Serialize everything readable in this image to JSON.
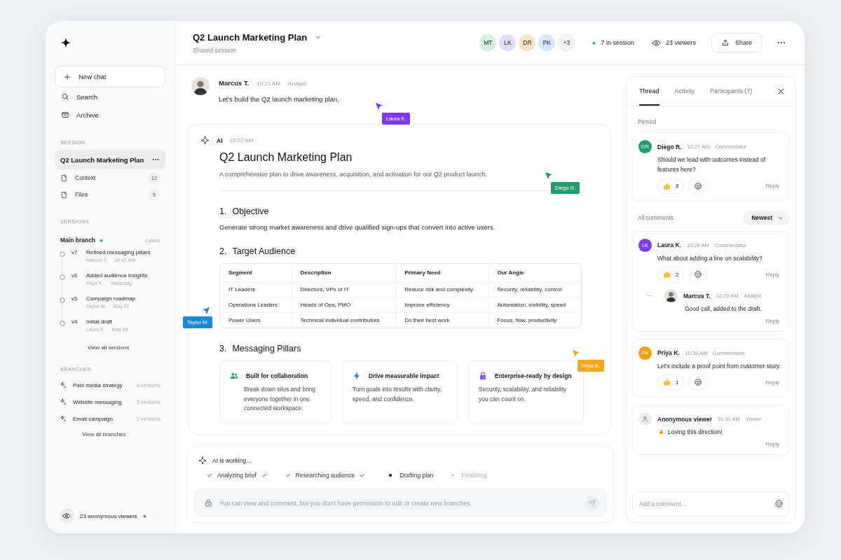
{
  "sidebar": {
    "new_chat": "New chat",
    "nav": [
      {
        "label": "Search",
        "kind": "search"
      },
      {
        "label": "Archive",
        "kind": "archive"
      }
    ],
    "session_heading": "SESSION",
    "session": {
      "title": "Q2 Launch Marketing Plan",
      "selected": true
    },
    "session_items": [
      {
        "label": "Context",
        "count": "12"
      },
      {
        "label": "Files",
        "count": "5"
      }
    ],
    "versions_heading": "VERSIONS",
    "main_branch": {
      "name": "Main branch",
      "badge": "Latest"
    },
    "versions": [
      {
        "version": "v7",
        "title": "Refined messaging pillars",
        "author": "Marcus T.",
        "time": "10:42 AM"
      },
      {
        "version": "v6",
        "title": "Added audience insights",
        "author": "Priya K.",
        "time": "Yesterday"
      },
      {
        "version": "v5",
        "title": "Campaign roadmap",
        "author": "Taylor M.",
        "time": "May 20"
      },
      {
        "version": "v4",
        "title": "Initial draft",
        "author": "Laura K.",
        "time": "May 18"
      }
    ],
    "view_all_versions": "View all versions",
    "branches_heading": "BRANCHES",
    "branches": [
      {
        "name": "Paid media strategy",
        "count": "4 versions"
      },
      {
        "name": "Website messaging",
        "count": "3 versions"
      },
      {
        "name": "Email campaign",
        "count": "2 versions"
      }
    ],
    "view_all_branches": "View all branches",
    "viewers": "23 anonymous viewers"
  },
  "header": {
    "title": "Q2 Launch Marketing Plan",
    "subtitle": "Shared session",
    "avatars": [
      {
        "initials": "MT",
        "color": "#d4eedf"
      },
      {
        "initials": "LK",
        "color": "#e4dafa"
      },
      {
        "initials": "DR",
        "color": "#fde2c4"
      },
      {
        "initials": "PK",
        "color": "#d7e6fb"
      }
    ],
    "more": "+3",
    "in_session": "7 in session",
    "viewers": "23 viewers",
    "share": "Share"
  },
  "chat": {
    "user_message": {
      "author": "Marcus T.",
      "time": "10:21 AM",
      "role": "Analyst",
      "text": "Let's build the Q2 launch marketing plan."
    },
    "ai_message": {
      "author": "AI",
      "time": "10:22 AM",
      "title": "Q2 Launch Marketing Plan",
      "subtitle": "A comprehensive plan to drive awareness, acquisition, and activation for our Q2 product launch.",
      "sections": [
        {
          "number": "1.",
          "heading": "Objective",
          "kind": "text",
          "text": "Generate strong market awareness and drive qualified sign-ups that convert into active users."
        },
        {
          "number": "2.",
          "heading": "Target Audience",
          "kind": "table",
          "table": {
            "columns": [
              "Segment",
              "Description",
              "Primary Need",
              "Our Angle"
            ],
            "rows": [
              [
                "IT Leaders",
                "Directors, VPs of IT",
                "Reduce risk and complexity",
                "Security, reliability, control"
              ],
              [
                "Operations Leaders",
                "Heads of Ops, PMO",
                "Improve efficiency",
                "Automation, visibility, speed"
              ],
              [
                "Power Users",
                "Technical individual contributors",
                "Do their best work",
                "Focus, flow, productivity"
              ]
            ]
          }
        },
        {
          "number": "3.",
          "heading": "Messaging Pillars",
          "kind": "pillars",
          "pillars": [
            {
              "kind": "people",
              "title": "Built for collaboration",
              "text": "Break down silos and bring everyone together in one connected workspace."
            },
            {
              "kind": "bolt",
              "title": "Drive measurable impact",
              "text": "Turn goals into results with clarity, speed, and confidence."
            },
            {
              "kind": "lock",
              "title": "Enterprise-ready by design",
              "text": "Security, scalability, and reliability you can count on."
            }
          ]
        }
      ]
    },
    "cursors": [
      {
        "name": "Laura K.",
        "color": "#7c3aed"
      },
      {
        "name": "Diego R.",
        "color": "#1f9d6a"
      },
      {
        "name": "Taylor M.",
        "color": "#1e88d8"
      },
      {
        "name": "Priya K.",
        "color": "#f5a524"
      }
    ],
    "status": "AI is working...",
    "steps": [
      {
        "label": "Analyzing brief",
        "kind": "done"
      },
      {
        "label": "Researching audience",
        "kind": "done"
      },
      {
        "label": "Drafting plan",
        "kind": "active"
      },
      {
        "label": "Finalizing",
        "kind": "pending"
      }
    ],
    "composer": {
      "placeholder": "You can view and comment, but you don't have permission to edit or create new branches."
    }
  },
  "panel": {
    "tabs": [
      {
        "label": "Thread",
        "selected": true
      },
      {
        "label": "Activity",
        "selected": false
      },
      {
        "label": "Participants (7)",
        "selected": false
      }
    ],
    "pinned_label": "Pinned",
    "pinned": [
      {
        "avatar": {
          "kind": "initials",
          "initials": "DR",
          "color": "#1f9d6a"
        },
        "name": "Diego R.",
        "time": "10:27 AM",
        "role": "Commentator",
        "text": "Should we lead with outcomes instead of features here?",
        "likes": "3",
        "reply": "Reply"
      }
    ],
    "all_label": "All comments",
    "sort": "Newest",
    "comments": [
      {
        "avatar": {
          "kind": "initials",
          "initials": "LK",
          "color": "#7c3aed"
        },
        "name": "Laura K.",
        "time": "10:28 AM",
        "role": "Commentator",
        "text": "What about adding a line on scalability?",
        "likes": "2",
        "reply": "Reply",
        "replies": [
          {
            "avatar": {
              "kind": "photo"
            },
            "name": "Marcus T.",
            "time": "10:29 AM",
            "role": "Analyst",
            "text": "Good call, added to the draft.",
            "reply": "Reply"
          }
        ]
      },
      {
        "avatar": {
          "kind": "initials",
          "initials": "PK",
          "color": "#f59e0b"
        },
        "name": "Priya K.",
        "time": "10:30 AM",
        "role": "Commentator",
        "text": "Let's include a proof point from customer story.",
        "likes": "1",
        "reply": "Reply"
      },
      {
        "avatar": {
          "kind": "anonymous"
        },
        "name": "Anonymous viewer",
        "time": "10:31 AM",
        "role": "Viewer",
        "kind": "fire",
        "text": "Loving this direction!",
        "reply": "Reply"
      }
    ],
    "comment_placeholder": "Add a comment..."
  }
}
